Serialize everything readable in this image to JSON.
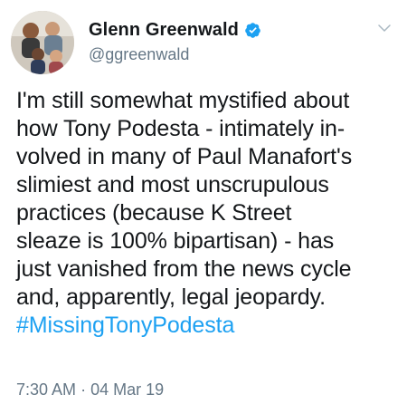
{
  "user": {
    "display_name": "Glenn Greenwald",
    "handle": "@ggreenwald",
    "verified": true,
    "avatar": "group-photo-avatar"
  },
  "tweet": {
    "text": "I'm still somewhat mystified about\nhow Tony Podesta - intimately in-\nvolved in many of Paul Manafort's\nslimiest and most unscrupulous\npractices (because K Street\nsleaze is 100% bipartisan) - has\njust vanished from the news cycle\nand, apparently, legal jeopardy.",
    "hashtag": "#MissingTonyPodesta"
  },
  "timestamp": {
    "time": "7:30 AM",
    "separator": "·",
    "date": "04 Mar 19"
  },
  "icons": {
    "verified": "verified-badge-icon",
    "menu": "chevron-down-icon"
  },
  "colors": {
    "text": "#14171a",
    "secondary": "#657786",
    "accent": "#1da1f2"
  }
}
